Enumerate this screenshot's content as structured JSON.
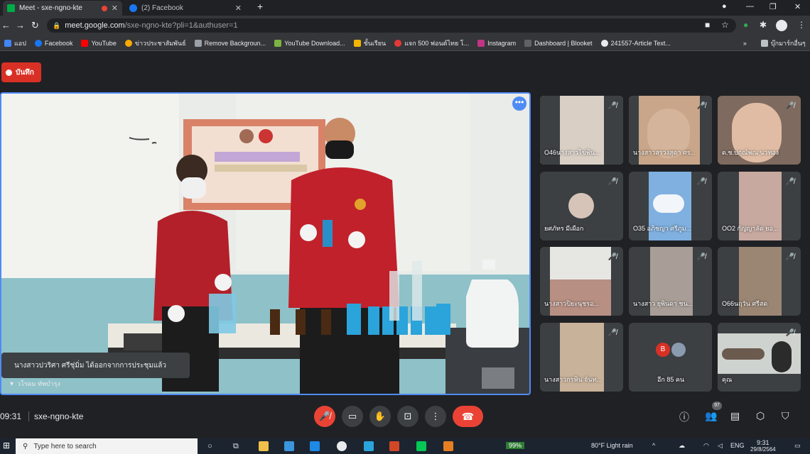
{
  "browser": {
    "tabs": [
      {
        "title": "Meet - sxe-ngno-kte",
        "active": true
      },
      {
        "title": "(2) Facebook",
        "active": false
      }
    ],
    "new_tab": "+",
    "url_host": "meet.google.com",
    "url_path": "/sxe-ngno-kte?pli=1&authuser=1",
    "bookmarks": [
      {
        "label": "แอป",
        "color": "#4285f4"
      },
      {
        "label": "Facebook",
        "color": "#1877f2"
      },
      {
        "label": "YouTube",
        "color": "#ff0000"
      },
      {
        "label": "ข่าวประชาสัมพันธ์",
        "color": "#f9ab00"
      },
      {
        "label": "Remove Backgroun...",
        "color": "#9aa0a6"
      },
      {
        "label": "YouTube Download...",
        "color": "#7cb342"
      },
      {
        "label": "ชั้นเรียน",
        "color": "#f4b400"
      },
      {
        "label": "แจก 500 ฟอนต์ไทย โ...",
        "color": "#e53935"
      },
      {
        "label": "Instagram",
        "color": "#c13584"
      },
      {
        "label": "Dashboard | Blooket",
        "color": "#5f6368"
      },
      {
        "label": "241557-Article Text...",
        "color": "#e8eaed"
      }
    ],
    "bookmarks_more": "»",
    "other_bookmarks": "บุ๊กมาร์กอื่นๆ"
  },
  "meet": {
    "record_label": "บันทึก",
    "toast": "นางสาวปวริศา ศรีชุ่มิ่ม ได้ออกจากการประชุมแล้ว",
    "main_speaker": "วโรดม ทัพบำรุง",
    "participants": [
      {
        "name": "O46นางสาวไข่พิน...",
        "bg": "#d9cfc5",
        "muted": true
      },
      {
        "name": "นางสาวสรวงสุดา ศร...",
        "bg": "#c9a68a",
        "muted": true
      },
      {
        "name": "ด.ช.ปฤณ์พณ นวทอง",
        "bg": "#7e6a5e",
        "muted": true
      },
      {
        "name": "ยศภัทร มีเผือก",
        "bg": "#3c4043",
        "muted": true,
        "avatar": true
      },
      {
        "name": "O35 อภิชญา ศรีภูม...",
        "bg": "#7fb0e0",
        "muted": true
      },
      {
        "name": "OO2 กัญญาลัด ยอ...",
        "bg": "#c7a9a0",
        "muted": true
      },
      {
        "name": "นางสาวปิยะนุชรอ...",
        "bg": "#b78f83",
        "muted": true
      },
      {
        "name": "นางสาว ยุพินดา ชน...",
        "bg": "#a89e97",
        "muted": true
      },
      {
        "name": "O66นฤวัน ศรีสด",
        "bg": "#9b8674",
        "muted": true
      },
      {
        "name": "นางสาวกรพิน จันท...",
        "bg": "#c9b29a",
        "muted": true
      },
      {
        "name": "อีก 85 คน",
        "bg": "#3c4043",
        "muted": false,
        "more": true,
        "initial": "B"
      },
      {
        "name": "คุณ",
        "bg": "#cfd3cf",
        "muted": true
      }
    ]
  },
  "controls": {
    "time": "09:31",
    "meeting_code": "sxe-ngno-kte",
    "people_count": "97"
  },
  "taskbar": {
    "search_placeholder": "Type here to search",
    "battery": "99%",
    "weather": "80°F  Light rain",
    "lang": "ENG",
    "time": "9:31",
    "date": "29/8/2564"
  }
}
